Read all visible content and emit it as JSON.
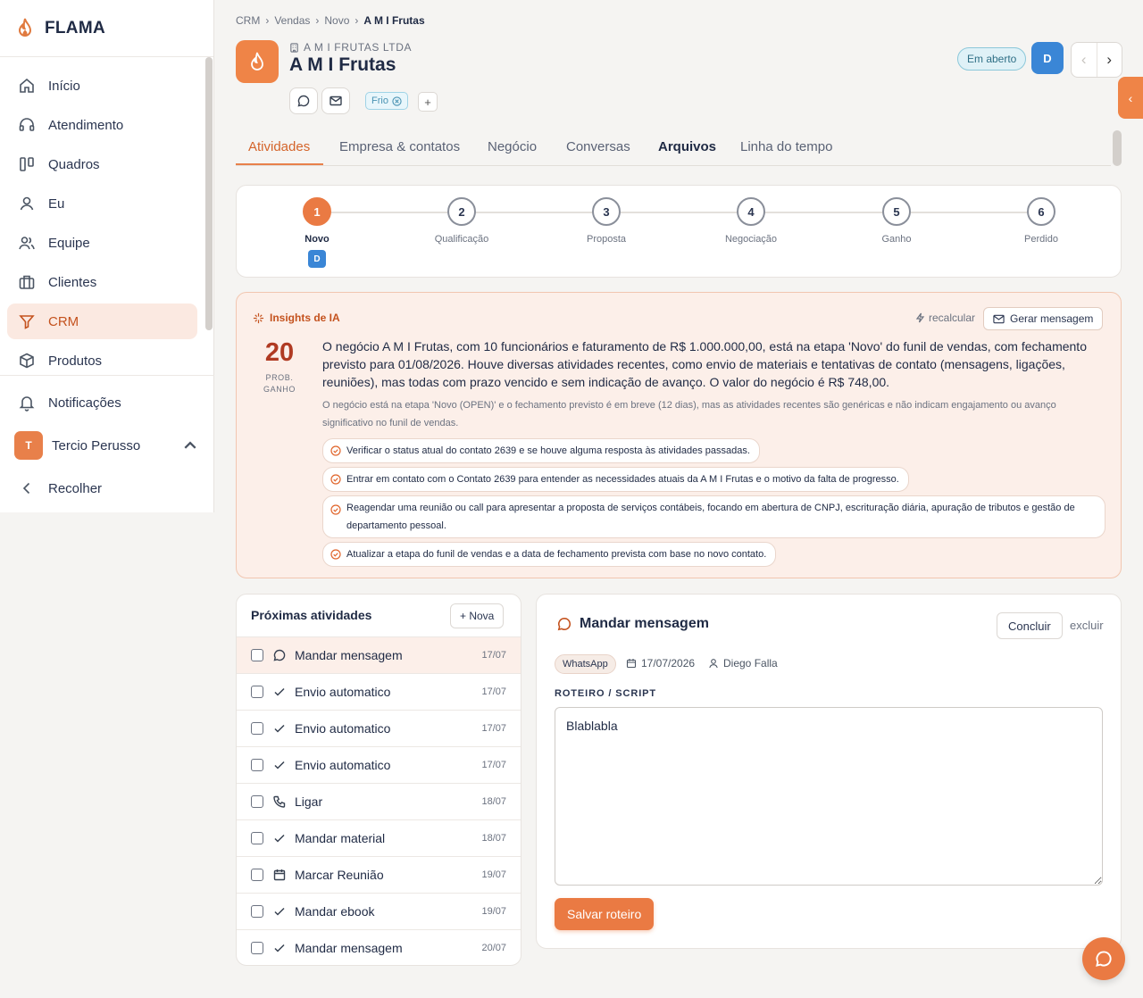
{
  "brand": {
    "name": "FLAMA"
  },
  "sidebar": {
    "items": [
      {
        "label": "Início",
        "icon": "home-icon"
      },
      {
        "label": "Atendimento",
        "icon": "headset-icon"
      },
      {
        "label": "Quadros",
        "icon": "kanban-icon"
      },
      {
        "label": "Eu",
        "icon": "user-icon"
      },
      {
        "label": "Equipe",
        "icon": "users-icon"
      },
      {
        "label": "Clientes",
        "icon": "building-icon"
      },
      {
        "label": "CRM",
        "icon": "funnel-icon",
        "active": true
      },
      {
        "label": "Produtos",
        "icon": "box-icon"
      }
    ],
    "notifications_label": "Notificações",
    "user": {
      "initial": "T",
      "name": "Tercio Perusso"
    },
    "collapse_label": "Recolher"
  },
  "breadcrumb": [
    "CRM",
    "Vendas",
    "Novo",
    "A M I Frutas"
  ],
  "header": {
    "company_legal": "A M I FRUTAS LTDA",
    "title": "A M I Frutas",
    "tag": "Frio",
    "tag_add": "+",
    "status": "Em aberto",
    "owner_initial": "D"
  },
  "tabs": [
    "Atividades",
    "Empresa & contatos",
    "Negócio",
    "Conversas",
    "Arquivos",
    "Linha do tempo"
  ],
  "stages": [
    {
      "num": "1",
      "label": "Novo",
      "active": true,
      "owner": "D"
    },
    {
      "num": "2",
      "label": "Qualificação"
    },
    {
      "num": "3",
      "label": "Proposta"
    },
    {
      "num": "4",
      "label": "Negociação"
    },
    {
      "num": "5",
      "label": "Ganho"
    },
    {
      "num": "6",
      "label": "Perdido"
    }
  ],
  "insights": {
    "title": "Insights de IA",
    "recalc": "recalcular",
    "generate": "Gerar mensagem",
    "prob": "20",
    "prob_label_1": "PROB.",
    "prob_label_2": "GANHO",
    "summary": "O negócio A M I Frutas, com 10 funcionários e faturamento de R$ 1.000.000,00, está na etapa 'Novo' do funil de vendas, com fechamento previsto para 01/08/2026. Houve diversas atividades recentes, como envio de materiais e tentativas de contato (mensagens, ligações, reuniões), mas todas com prazo vencido e sem indicação de avanço. O valor do negócio é R$ 748,00.",
    "analysis": "O negócio está na etapa 'Novo (OPEN)' e o fechamento previsto é em breve (12 dias), mas as atividades recentes são genéricas e não indicam engajamento ou avanço significativo no funil de vendas.",
    "suggestions": [
      "Verificar o status atual do contato 2639 e se houve alguma resposta às atividades passadas.",
      "Entrar em contato com o Contato 2639 para entender as necessidades atuais da A M I Frutas e o motivo da falta de progresso.",
      "Reagendar uma reunião ou call para apresentar a proposta de serviços contábeis, focando em abertura de CNPJ, escrituração diária, apuração de tributos e gestão de departamento pessoal.",
      "Atualizar a etapa do funil de vendas e a data de fechamento prevista com base no novo contato."
    ]
  },
  "activities": {
    "title": "Próximas atividades",
    "new_label": "+ Nova",
    "items": [
      {
        "name": "Mandar mensagem",
        "date": "17/07",
        "icon": "chat-icon",
        "selected": true
      },
      {
        "name": "Envio automatico",
        "date": "17/07",
        "icon": "check-icon"
      },
      {
        "name": "Envio automatico",
        "date": "17/07",
        "icon": "check-icon"
      },
      {
        "name": "Envio automatico",
        "date": "17/07",
        "icon": "check-icon"
      },
      {
        "name": "Ligar",
        "date": "18/07",
        "icon": "phone-icon"
      },
      {
        "name": "Mandar material",
        "date": "18/07",
        "icon": "check-icon"
      },
      {
        "name": "Marcar Reunião",
        "date": "19/07",
        "icon": "calendar-icon"
      },
      {
        "name": "Mandar ebook",
        "date": "19/07",
        "icon": "check-icon"
      },
      {
        "name": "Mandar mensagem",
        "date": "20/07",
        "icon": "check-icon"
      }
    ]
  },
  "detail": {
    "title": "Mandar mensagem",
    "complete": "Concluir",
    "delete": "excluir",
    "channel": "WhatsApp",
    "date": "17/07/2026",
    "assignee": "Diego Falla",
    "script_label": "ROTEIRO / SCRIPT",
    "script_value": "Blablabla",
    "save": "Salvar roteiro"
  },
  "colors": {
    "accent": "#ea7a43",
    "owner": "#3a86d6",
    "insight_bg": "#fcefe9"
  }
}
